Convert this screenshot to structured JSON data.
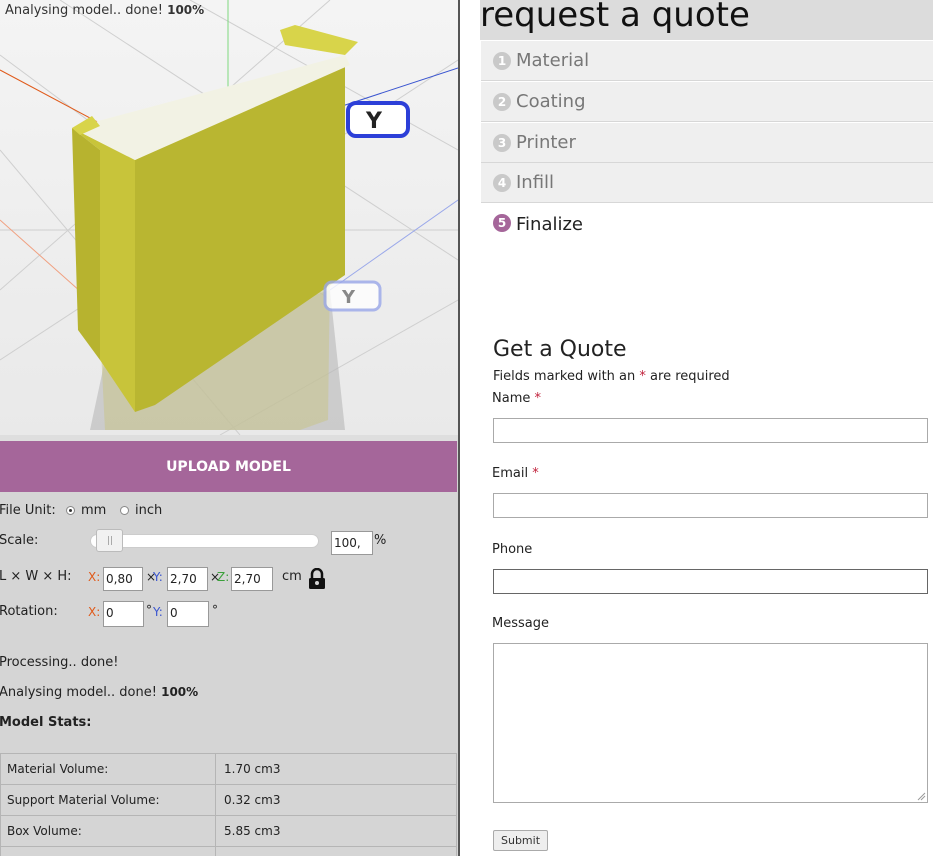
{
  "viewer": {
    "status_text": "Analysing model.. done!",
    "status_pct": "100%",
    "axis_gizmo_label": "Y",
    "model_color": "#c8c43a"
  },
  "upload": {
    "label": "UPLOAD MODEL",
    "color": "#a5669a"
  },
  "settings": {
    "file_unit_label": "File Unit:",
    "unit_options": [
      {
        "label": "mm",
        "selected": true
      },
      {
        "label": "inch",
        "selected": false
      }
    ],
    "scale_label": "Scale:",
    "scale_value": "100,",
    "scale_unit": "%",
    "dims_label": "L × W × H:",
    "x_axis": "X:",
    "y_axis": "Y:",
    "z_axis": "Z:",
    "times": "×",
    "dim_x": "0,80",
    "dim_y": "2,70",
    "dim_z": "2,70",
    "dim_unit": "cm",
    "rotation_label": "Rotation:",
    "rot_x": "0",
    "rot_y": "0",
    "degree": "°"
  },
  "log": {
    "processing": "Processing.. done!",
    "analysing": "Analysing model.. done!",
    "analysing_pct": "100%",
    "stats_heading": "Model Stats:"
  },
  "stats": [
    {
      "label": "Material Volume:",
      "value": "1.70 cm3"
    },
    {
      "label": "Support Material Volume:",
      "value": "0.32 cm3"
    },
    {
      "label": "Box Volume:",
      "value": "5.85 cm3"
    }
  ],
  "quote": {
    "title": "request a quote",
    "steps": [
      {
        "num": "1",
        "label": "Material",
        "active": false
      },
      {
        "num": "2",
        "label": "Coating",
        "active": false
      },
      {
        "num": "3",
        "label": "Printer",
        "active": false
      },
      {
        "num": "4",
        "label": "Infill",
        "active": false
      },
      {
        "num": "5",
        "label": "Finalize",
        "active": true
      }
    ]
  },
  "form": {
    "title": "Get a Quote",
    "note_before": "Fields marked with an",
    "note_star": "*",
    "note_after": "are required",
    "name_label": "Name",
    "email_label": "Email",
    "phone_label": "Phone",
    "message_label": "Message",
    "required_mark": "*",
    "submit": "Submit"
  }
}
